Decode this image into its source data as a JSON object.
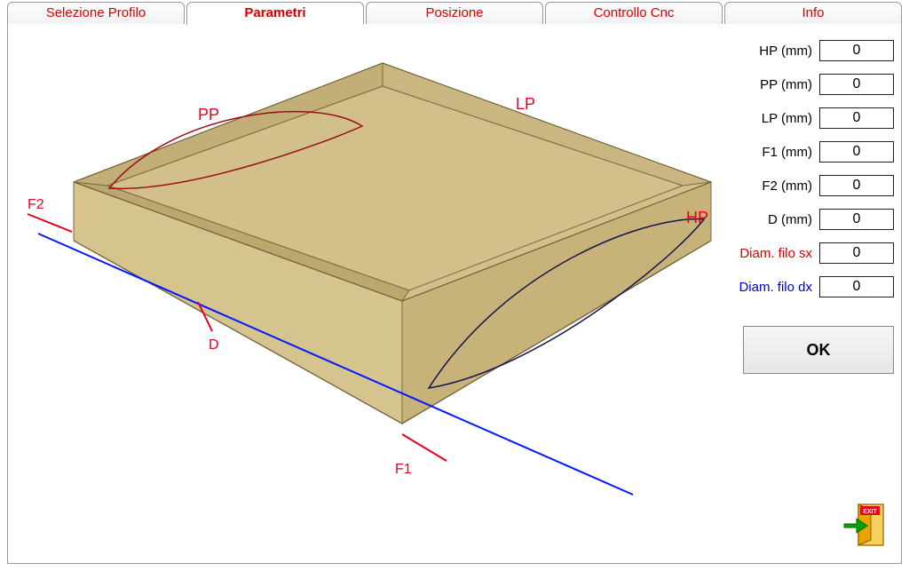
{
  "tabs": {
    "selezione_profilo": "Selezione Profilo",
    "parametri": "Parametri",
    "posizione": "Posizione",
    "controllo_cnc": "Controllo Cnc",
    "info": "Info"
  },
  "illustration_labels": {
    "pp": "PP",
    "lp": "LP",
    "hp": "HP",
    "f1": "F1",
    "f2": "F2",
    "d": "D"
  },
  "form": {
    "hp": {
      "label": "HP (mm)",
      "value": "0"
    },
    "pp": {
      "label": "PP (mm)",
      "value": "0"
    },
    "lp": {
      "label": "LP (mm)",
      "value": "0"
    },
    "f1": {
      "label": "F1 (mm)",
      "value": "0"
    },
    "f2": {
      "label": "F2 (mm)",
      "value": "0"
    },
    "d": {
      "label": "D (mm)",
      "value": "0"
    },
    "diam_sx": {
      "label": "Diam. filo sx",
      "value": "0"
    },
    "diam_dx": {
      "label": "Diam. filo dx",
      "value": "0"
    }
  },
  "buttons": {
    "ok": "OK",
    "exit_icon_text": "EXIT"
  }
}
